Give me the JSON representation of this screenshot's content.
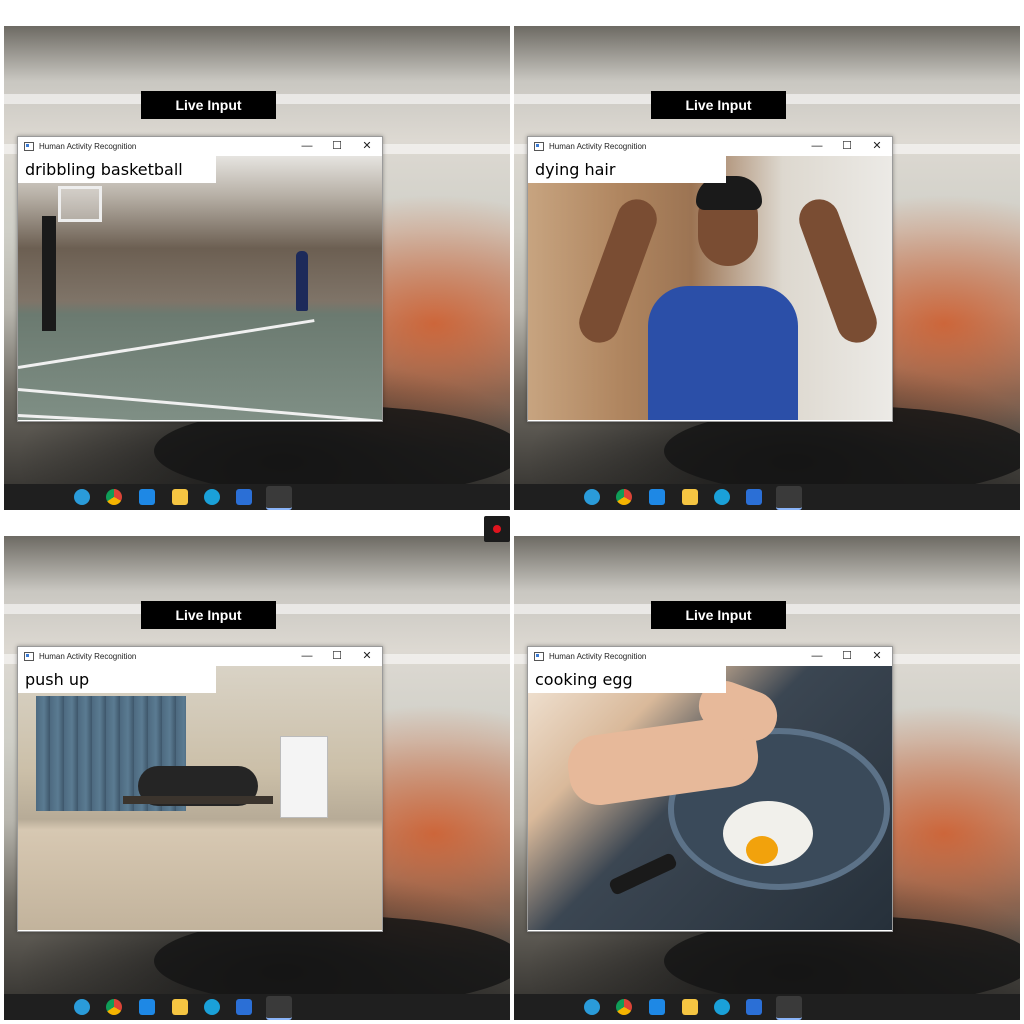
{
  "app_title": "Human Activity Recognition",
  "live_label": "Live Input",
  "panels": [
    {
      "prediction": "dribbling basketball"
    },
    {
      "prediction": "dying hair"
    },
    {
      "prediction": "push up"
    },
    {
      "prediction": "cooking egg"
    }
  ],
  "window_controls": {
    "minimize": "—",
    "maximize": "☐",
    "close": "✕"
  },
  "taskbar_icons": [
    "telegram-icon",
    "chrome-icon",
    "blue-app-icon",
    "file-explorer-icon",
    "edge-icon",
    "word-icon",
    "python-icon"
  ],
  "colors": {
    "taskbar": "#1f1f1f",
    "label_bg": "#000000",
    "record": "#e0141e"
  }
}
